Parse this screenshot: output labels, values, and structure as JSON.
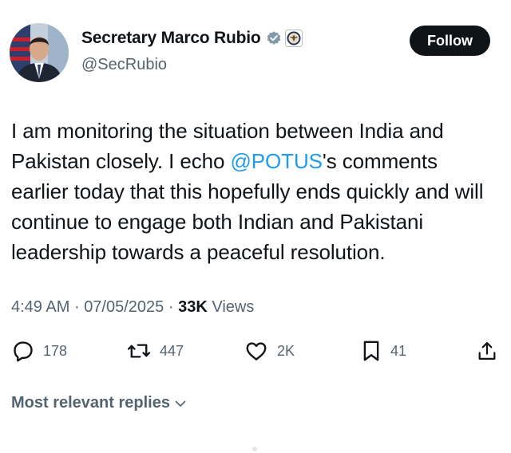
{
  "header": {
    "display_name": "Secretary Marco Rubio",
    "handle": "@SecRubio",
    "verified_icon": "verified-badge-icon",
    "affiliate_icon": "state-department-seal-icon",
    "follow_label": "Follow"
  },
  "tweet": {
    "text_before": "I am monitoring the situation between India and Pakistan closely. I echo ",
    "mention": "@POTUS",
    "text_after": "'s comments earlier today that this hopefully ends quickly and will continue to engage both Indian and Pakistani leadership towards a peaceful resolution."
  },
  "meta": {
    "time": "4:49 AM",
    "separator": "·",
    "date": "07/05/2025",
    "views_count": "33K",
    "views_label": "Views"
  },
  "actions": [
    {
      "icon": "reply-icon",
      "count": "178"
    },
    {
      "icon": "retweet-icon",
      "count": "447"
    },
    {
      "icon": "like-icon",
      "count": "2K"
    },
    {
      "icon": "bookmark-icon",
      "count": "41"
    },
    {
      "icon": "share-icon",
      "count": ""
    }
  ],
  "replies": {
    "label": "Most relevant replies"
  },
  "colors": {
    "text": "#0f1419",
    "secondary": "#536471",
    "mention": "#1d9bf0",
    "follow_bg": "#0f1419",
    "verified_badge": "#829aab"
  }
}
